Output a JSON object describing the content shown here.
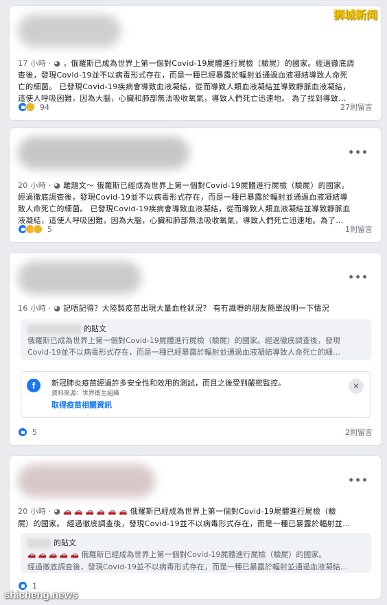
{
  "watermarks": {
    "top_right": "狮城新闻",
    "bottom_left": "shicheng.news"
  },
  "posts": [
    {
      "time": "17 小時",
      "sep": "·",
      "text_lines": [
        "，俄羅斯已成為世界上第一個對Covid-19屍體進行屍檢（驗屍）的國家。經過徹底調",
        "查後，發現Covid-19並不以病毒形式存在，而是一種已經暴露於輻射並通過血液凝結導致人命死",
        "亡的細菌。 已發現Covid-19疾病會導致血液凝結，從而導致人類血液凝結並導致靜脈血液凝結，",
        "這使人呼吸困難，因為大腦，心臟和肺部無法吸收氧氣，導致人們死亡迅速地。 為了找到導致…"
      ],
      "reaction_count": "94",
      "comments": "27則留言"
    },
    {
      "time": "20 小時",
      "sep": "·",
      "prefix": "離題文～",
      "text_lines": [
        "俄羅斯已經成為世界上第一個對Covid-19屍體進行屍檢（驗屍）的國家。",
        "經過徹底調查後，發現Covid-19並不以病毒形式存在，而是一種已暴露於輻射並通過血液凝結導",
        "致人命死亡的細菌。 已發現Covid-19疾病會導致血液凝結，從而導致人類血液凝結並導致靜脈血",
        "液凝結，這使人呼吸困難，因為大腦，心臟和肺部無法吸收氧氣，導致人們死亡迅速地。為了…"
      ],
      "reaction_count": "5",
      "comments": "1則留言"
    },
    {
      "time": "16 小時",
      "sep": "·",
      "text": "記唔記得？大陸製疫苗出現大量血栓狀況？ 有冇識嘢的朋友簡單說明一下情況",
      "quote_suffix": "的貼文",
      "quote_lines": [
        "俄羅斯已成為世界上第一個對Covid-19屍體進行屍檢（驗屍）的國家。經過徹底調查後，發現",
        "Covid-19並不以病毒形式存在，而是一種已經暴露於輻射並通過血液凝結導致人命死亡的細…"
      ],
      "notice_title": "新冠肺炎疫苗經過許多安全性和效用的測試，而且之後受到嚴密監控。",
      "notice_source": "資料來源：世界衛生組織",
      "notice_link": "取得疫苗相關資訊",
      "reaction_count": "5",
      "comments": "2則留言"
    },
    {
      "time": "20 小時",
      "sep": "·",
      "cars": "🚗 🚗 🚗 🚗 🚗 🚗",
      "text_lines": [
        "俄羅斯已經成為世界上第一個對Covid-19屍體進行屍檢（驗",
        "屍）的國家。 經過徹底調查後，發現Covid-19並不以病毒形式存在，而是一種已暴露於輻射並…"
      ],
      "quote_suffix": "的貼文",
      "quote_cars": "🚗 🚗 🚗 🚗 🚗",
      "quote_lines": [
        "俄羅斯已經成為世界上第一個對Covid-19屍體進行屍檢（驗屍）的國家。",
        "經過徹底調查後，發現Covid-19並不以病毒形式存在，而是一種已暴露於輻射並通過血液凝結…"
      ],
      "reaction_count": "1"
    }
  ]
}
